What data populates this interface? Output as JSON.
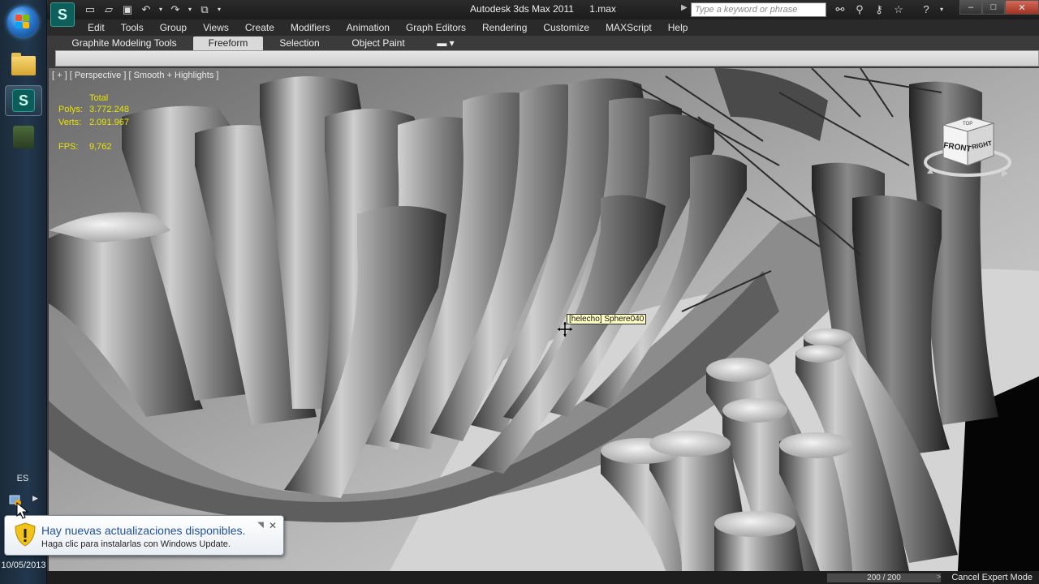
{
  "taskbar": {
    "language": "ES",
    "clock_time": "",
    "clock_date": "10/05/2013"
  },
  "window": {
    "app_name": "Autodesk 3ds Max  2011",
    "file_name": "1.max",
    "search_placeholder": "Type a keyword or phrase"
  },
  "menu": [
    "Edit",
    "Tools",
    "Group",
    "Views",
    "Create",
    "Modifiers",
    "Animation",
    "Graph Editors",
    "Rendering",
    "Customize",
    "MAXScript",
    "Help"
  ],
  "ribbon": {
    "tabs": [
      "Graphite Modeling Tools",
      "Freeform",
      "Selection",
      "Object Paint"
    ],
    "active_tab": "Freeform"
  },
  "viewport": {
    "label": "[ + ] [ Perspective ] [ Smooth + Highlights ]",
    "stats": {
      "header": "Total",
      "polys_label": "Polys:",
      "polys_value": "3.772.248",
      "verts_label": "Verts:",
      "verts_value": "2.091.967",
      "fps_label": "FPS:",
      "fps_value": "9,762"
    },
    "tooltip": "[helecho] Sphere040",
    "viewcube": {
      "front": "FRONT",
      "right": "RIGHT",
      "top": "TOP"
    }
  },
  "status": {
    "frame": "200 / 200",
    "expert_mode": "Cancel Expert Mode"
  },
  "notification": {
    "title": "Hay nuevas actualizaciones disponibles.",
    "body": "Haga clic para instalarlas con Windows Update."
  },
  "colors": {
    "stats_yellow": "#e9e400",
    "tooltip_bg": "#ffffc6",
    "balloon_title": "#1f4f9c"
  }
}
